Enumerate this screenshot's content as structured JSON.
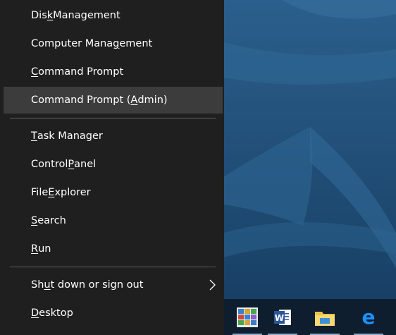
{
  "menu": {
    "items": [
      {
        "pre": "Dis",
        "u": "k",
        "post": " Management"
      },
      {
        "pre": "Computer Mana",
        "u": "g",
        "post": "ement"
      },
      {
        "pre": "",
        "u": "C",
        "post": "ommand Prompt"
      },
      {
        "pre": "Command Prompt (",
        "u": "A",
        "post": "dmin)"
      },
      {
        "pre": "",
        "u": "T",
        "post": "ask Manager"
      },
      {
        "pre": "Control ",
        "u": "P",
        "post": "anel"
      },
      {
        "pre": "File ",
        "u": "E",
        "post": "xplorer"
      },
      {
        "pre": "",
        "u": "S",
        "post": "earch"
      },
      {
        "pre": "",
        "u": "R",
        "post": "un"
      },
      {
        "pre": "Sh",
        "u": "u",
        "post": "t down or sign out"
      },
      {
        "pre": "",
        "u": "D",
        "post": "esktop"
      }
    ],
    "highlighted_index": 3
  },
  "taskbar": {
    "apps": [
      {
        "icon": "control-panel-icon",
        "running": true
      },
      {
        "icon": "word-icon",
        "label": "W",
        "running": true
      },
      {
        "icon": "file-explorer-icon",
        "running": true
      },
      {
        "icon": "edge-icon",
        "label": "e",
        "running": true
      }
    ]
  },
  "colors": {
    "menu_bg": "#1f1f1f",
    "menu_highlight": "#3c3c3c",
    "desktop_bg": "#1d4a72",
    "taskbar_bg": "#0e1e2e"
  }
}
